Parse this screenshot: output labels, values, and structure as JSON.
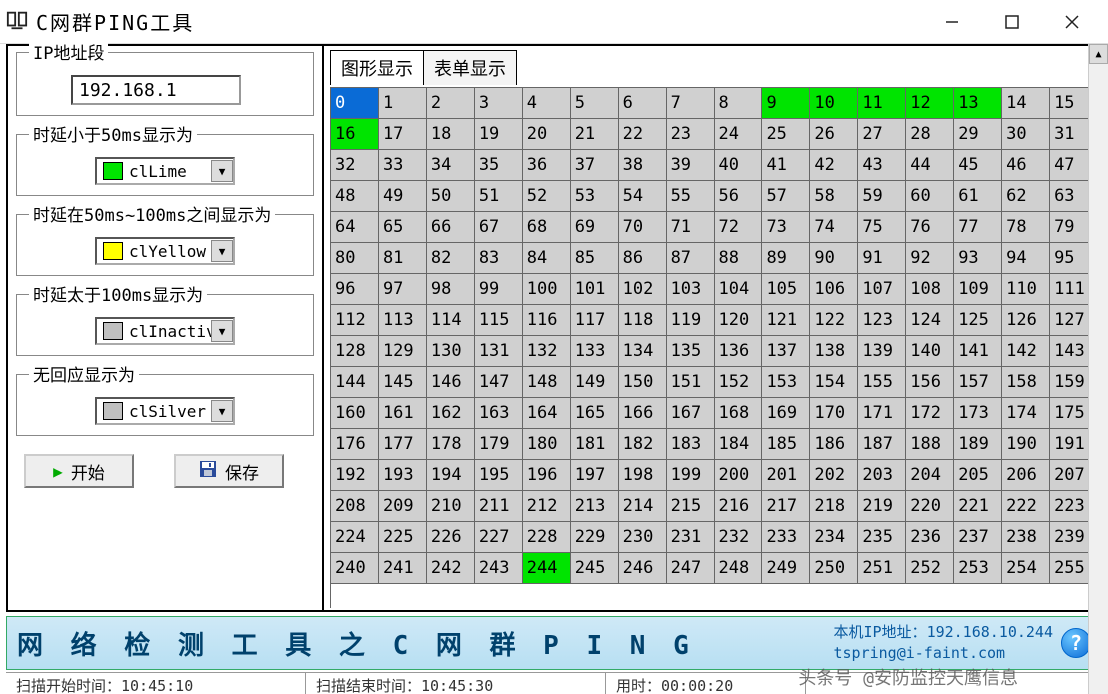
{
  "window": {
    "title": "C网群PING工具"
  },
  "left": {
    "ip_label": "IP地址段",
    "ip_value": "192.168.1",
    "lt50_label": "时延小于50ms显示为",
    "lt50_value": "clLime",
    "lt50_color": "#00e400",
    "mid_label": "时延在50ms~100ms之间显示为",
    "mid_value": "clYellow",
    "mid_color": "#ffff00",
    "gt100_label": "时延太于100ms显示为",
    "gt100_value": "clInactiv",
    "gt100_color": "#c0c0c0",
    "none_label": "无回应显示为",
    "none_value": "clSilver",
    "none_color": "#c0c0c0",
    "start_label": "开始",
    "save_label": "保存"
  },
  "tabs": {
    "graph": "图形显示",
    "list": "表单显示"
  },
  "grid": {
    "selected": 0,
    "lime": [
      9,
      10,
      11,
      12,
      13,
      16,
      244
    ]
  },
  "banner": {
    "big": "网 络 检 测 工 具 之 C 网 群 P I N G",
    "local_label": "本机IP地址：",
    "local_ip": "192.168.10.244",
    "email": "tspring@i-faint.com"
  },
  "status": {
    "s1": "扫描开始时间：10:45:10",
    "s2": "扫描结束时间：10:45:30",
    "s3": "用时：00:00:20",
    "s4": ""
  },
  "watermark": "头条号 @安防监控天鹰信息"
}
